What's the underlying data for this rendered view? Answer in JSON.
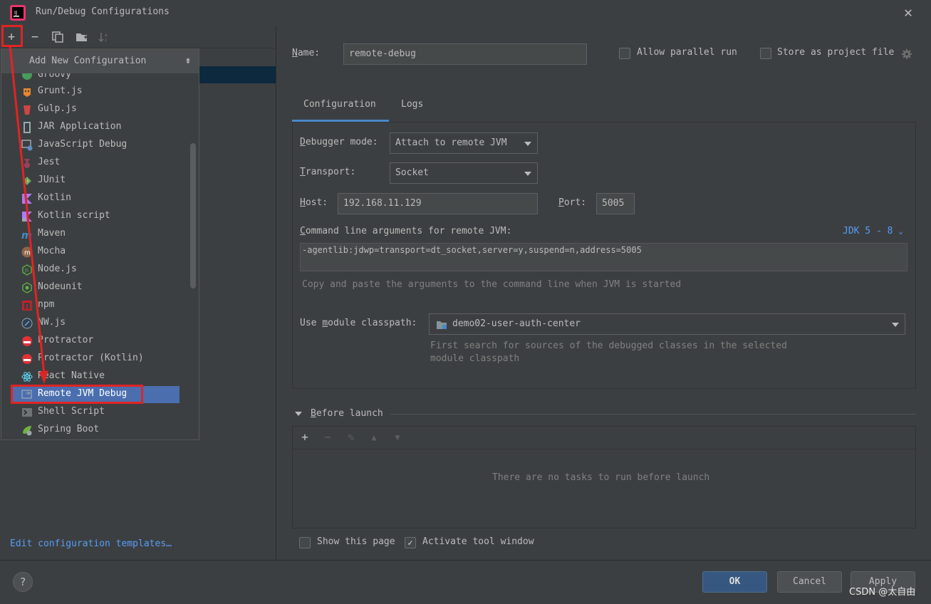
{
  "window": {
    "title": "Run/Debug Configurations"
  },
  "toolbar": {
    "add": "+",
    "remove": "−",
    "copy_icon": "copy-icon",
    "folder_icon": "folder-add-icon",
    "sort_icon": "sort-icon"
  },
  "popup": {
    "title": "Add New Configuration",
    "items": [
      {
        "label": "Groovy",
        "icon": "groovy-icon"
      },
      {
        "label": "Grunt.js",
        "icon": "grunt-icon"
      },
      {
        "label": "Gulp.js",
        "icon": "gulp-icon"
      },
      {
        "label": "JAR Application",
        "icon": "jar-icon"
      },
      {
        "label": "JavaScript Debug",
        "icon": "js-debug-icon"
      },
      {
        "label": "Jest",
        "icon": "jest-icon"
      },
      {
        "label": "JUnit",
        "icon": "junit-icon"
      },
      {
        "label": "Kotlin",
        "icon": "kotlin-icon"
      },
      {
        "label": "Kotlin script",
        "icon": "kotlin-script-icon"
      },
      {
        "label": "Maven",
        "icon": "maven-icon"
      },
      {
        "label": "Mocha",
        "icon": "mocha-icon"
      },
      {
        "label": "Node.js",
        "icon": "nodejs-icon"
      },
      {
        "label": "Nodeunit",
        "icon": "nodeunit-icon"
      },
      {
        "label": "npm",
        "icon": "npm-icon"
      },
      {
        "label": "NW.js",
        "icon": "nwjs-icon"
      },
      {
        "label": "Protractor",
        "icon": "protractor-icon"
      },
      {
        "label": "Protractor (Kotlin)",
        "icon": "protractor-icon"
      },
      {
        "label": "React Native",
        "icon": "react-icon"
      },
      {
        "label": "Remote JVM Debug",
        "icon": "remote-debug-icon"
      },
      {
        "label": "Shell Script",
        "icon": "shell-icon"
      },
      {
        "label": "Spring Boot",
        "icon": "spring-boot-icon"
      }
    ]
  },
  "left": {
    "edit_templates": "Edit configuration templates…"
  },
  "form": {
    "name_label": "Name:",
    "name_value": "remote-debug",
    "allow_parallel": "Allow parallel run",
    "store_project": "Store as project file",
    "tabs": [
      "Configuration",
      "Logs"
    ],
    "debugger_mode_label": "Debugger mode:",
    "debugger_mode_value": "Attach to remote JVM",
    "transport_label": "Transport:",
    "transport_value": "Socket",
    "host_label": "Host:",
    "host_value": "192.168.11.129",
    "port_label": "Port:",
    "port_value": "5005",
    "cmd_label": "Command line arguments for remote JVM:",
    "jdk_link": "JDK 5 - 8",
    "cmd_value": "-agentlib:jdwp=transport=dt_socket,server=y,suspend=n,address=5005",
    "cmd_hint": "Copy and paste the arguments to the command line when JVM is started",
    "module_label": "Use module classpath:",
    "module_value": "demo02-user-auth-center",
    "module_hint_1": "First search for sources of the debugged classes in the selected",
    "module_hint_2": "module classpath"
  },
  "before_launch": {
    "title": "Before launch",
    "empty": "There are no tasks to run before launch"
  },
  "footer": {
    "show_page": "Show this page",
    "activate_tool": "Activate tool window",
    "activate_checked": true,
    "ok": "OK",
    "cancel": "Cancel",
    "apply": "Apply",
    "help": "?"
  },
  "watermark": "CSDN @太自由",
  "colors": {
    "accent": "#4b6eaf",
    "link": "#589df6",
    "highlight_red": "#e02424",
    "bg": "#3c3f41"
  }
}
